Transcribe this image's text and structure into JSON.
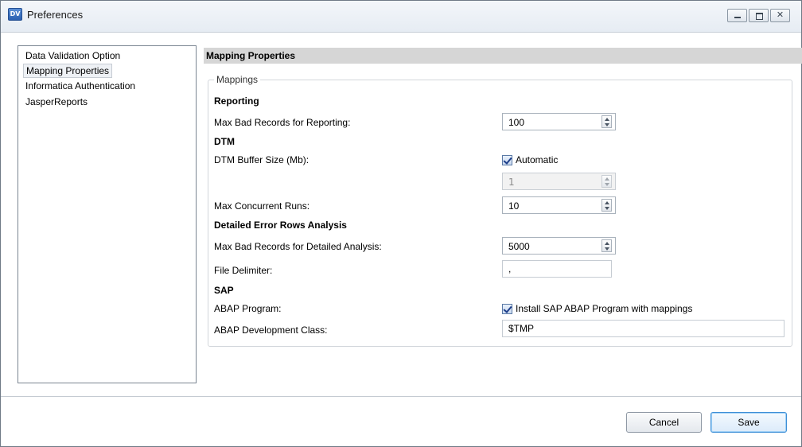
{
  "window": {
    "title": "Preferences",
    "app_icon": "DV"
  },
  "window_controls": {
    "close_glyph": "✕"
  },
  "nav": {
    "items": [
      {
        "label": "Data Validation Option"
      },
      {
        "label": "Mapping Properties",
        "selected": true
      },
      {
        "label": "Informatica Authentication"
      },
      {
        "label": "JasperReports"
      }
    ]
  },
  "panel": {
    "title": "Mapping Properties",
    "group_label": "Mappings",
    "reporting": {
      "heading": "Reporting",
      "max_bad_records_label": "Max Bad Records for Reporting:",
      "max_bad_records_value": "100"
    },
    "dtm": {
      "heading": "DTM",
      "buffer_size_label": "DTM Buffer Size (Mb):",
      "automatic_label": "Automatic",
      "automatic_checked": true,
      "buffer_size_value": "1",
      "max_concurrent_label": "Max Concurrent Runs:",
      "max_concurrent_value": "10"
    },
    "detailed": {
      "heading": "Detailed Error Rows Analysis",
      "max_bad_detailed_label": "Max Bad Records for Detailed Analysis:",
      "max_bad_detailed_value": "5000",
      "file_delimiter_label": "File Delimiter:",
      "file_delimiter_value": ","
    },
    "sap": {
      "heading": "SAP",
      "abap_program_label": "ABAP Program:",
      "install_abap_label": "Install SAP ABAP Program with mappings",
      "install_abap_checked": true,
      "abap_dev_class_label": "ABAP Development Class:",
      "abap_dev_class_value": "$TMP"
    }
  },
  "footer": {
    "cancel_label": "Cancel",
    "save_label": "Save"
  }
}
